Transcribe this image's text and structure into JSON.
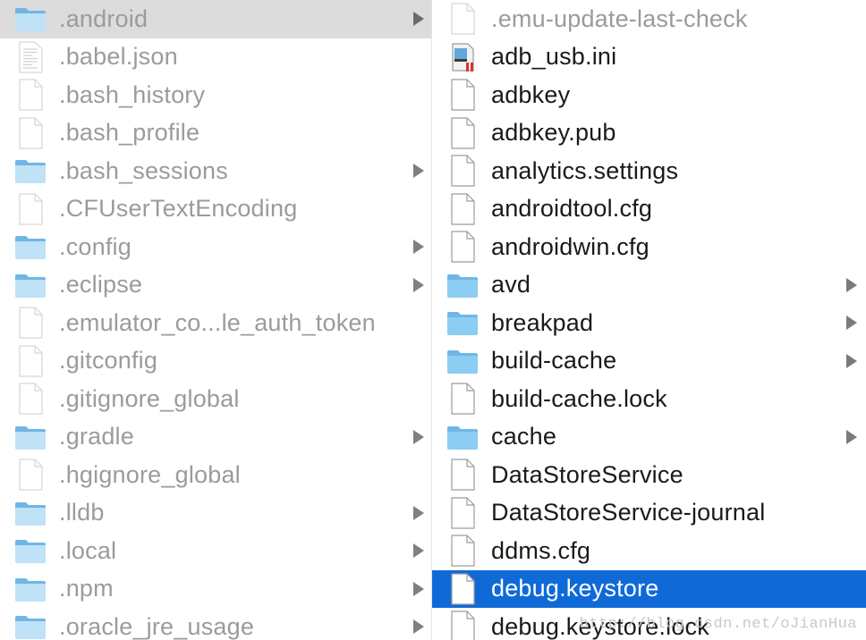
{
  "colors": {
    "selected_bg": "#0f6ad8",
    "parent_selected_bg": "#dcdcdc",
    "folder_blue": "#8ccdf3",
    "dim_text": "#9b9b9b",
    "active_text": "#1a1a1a"
  },
  "left_column": {
    "items": [
      {
        "name": ".android",
        "kind": "folder",
        "icon": "folder-icon",
        "has_children": true,
        "state": "parent-selected"
      },
      {
        "name": ".babel.json",
        "kind": "document",
        "icon": "json-document-icon",
        "has_children": false,
        "state": ""
      },
      {
        "name": ".bash_history",
        "kind": "file",
        "icon": "file-icon",
        "has_children": false,
        "state": ""
      },
      {
        "name": ".bash_profile",
        "kind": "file",
        "icon": "file-icon",
        "has_children": false,
        "state": ""
      },
      {
        "name": ".bash_sessions",
        "kind": "folder",
        "icon": "folder-icon",
        "has_children": true,
        "state": ""
      },
      {
        "name": ".CFUserTextEncoding",
        "kind": "file",
        "icon": "file-icon",
        "has_children": false,
        "state": ""
      },
      {
        "name": ".config",
        "kind": "folder",
        "icon": "folder-icon",
        "has_children": true,
        "state": ""
      },
      {
        "name": ".eclipse",
        "kind": "folder",
        "icon": "folder-icon",
        "has_children": true,
        "state": ""
      },
      {
        "name": ".emulator_co...le_auth_token",
        "kind": "file",
        "icon": "file-icon",
        "has_children": false,
        "state": ""
      },
      {
        "name": ".gitconfig",
        "kind": "file",
        "icon": "file-icon",
        "has_children": false,
        "state": ""
      },
      {
        "name": ".gitignore_global",
        "kind": "file",
        "icon": "file-icon",
        "has_children": false,
        "state": ""
      },
      {
        "name": ".gradle",
        "kind": "folder",
        "icon": "folder-icon",
        "has_children": true,
        "state": ""
      },
      {
        "name": ".hgignore_global",
        "kind": "file",
        "icon": "file-icon",
        "has_children": false,
        "state": ""
      },
      {
        "name": ".lldb",
        "kind": "folder",
        "icon": "folder-icon",
        "has_children": true,
        "state": ""
      },
      {
        "name": ".local",
        "kind": "folder",
        "icon": "folder-icon",
        "has_children": true,
        "state": ""
      },
      {
        "name": ".npm",
        "kind": "folder",
        "icon": "folder-icon",
        "has_children": true,
        "state": ""
      },
      {
        "name": ".oracle_jre_usage",
        "kind": "folder",
        "icon": "folder-icon",
        "has_children": true,
        "state": ""
      }
    ]
  },
  "right_column": {
    "items": [
      {
        "name": ".emu-update-last-check",
        "kind": "file",
        "icon": "file-icon",
        "has_children": false,
        "state": "faded"
      },
      {
        "name": "adb_usb.ini",
        "kind": "ini",
        "icon": "ini-file-icon",
        "has_children": false,
        "state": ""
      },
      {
        "name": "adbkey",
        "kind": "file",
        "icon": "file-icon",
        "has_children": false,
        "state": ""
      },
      {
        "name": "adbkey.pub",
        "kind": "file",
        "icon": "file-icon",
        "has_children": false,
        "state": ""
      },
      {
        "name": "analytics.settings",
        "kind": "file",
        "icon": "file-icon",
        "has_children": false,
        "state": ""
      },
      {
        "name": "androidtool.cfg",
        "kind": "file",
        "icon": "file-icon",
        "has_children": false,
        "state": ""
      },
      {
        "name": "androidwin.cfg",
        "kind": "file",
        "icon": "file-icon",
        "has_children": false,
        "state": ""
      },
      {
        "name": "avd",
        "kind": "folder",
        "icon": "folder-icon",
        "has_children": true,
        "state": ""
      },
      {
        "name": "breakpad",
        "kind": "folder",
        "icon": "folder-icon",
        "has_children": true,
        "state": ""
      },
      {
        "name": "build-cache",
        "kind": "folder",
        "icon": "folder-icon",
        "has_children": true,
        "state": ""
      },
      {
        "name": "build-cache.lock",
        "kind": "file",
        "icon": "file-icon",
        "has_children": false,
        "state": ""
      },
      {
        "name": "cache",
        "kind": "folder",
        "icon": "folder-icon",
        "has_children": true,
        "state": ""
      },
      {
        "name": "DataStoreService",
        "kind": "file",
        "icon": "file-icon",
        "has_children": false,
        "state": ""
      },
      {
        "name": "DataStoreService-journal",
        "kind": "file",
        "icon": "file-icon",
        "has_children": false,
        "state": ""
      },
      {
        "name": "ddms.cfg",
        "kind": "file",
        "icon": "file-icon",
        "has_children": false,
        "state": ""
      },
      {
        "name": "debug.keystore",
        "kind": "file",
        "icon": "file-icon",
        "has_children": false,
        "state": "selected"
      },
      {
        "name": "debug.keystore.lock",
        "kind": "file",
        "icon": "file-icon",
        "has_children": false,
        "state": ""
      }
    ]
  },
  "watermark": "http://blog.csdn.net/oJianHua"
}
